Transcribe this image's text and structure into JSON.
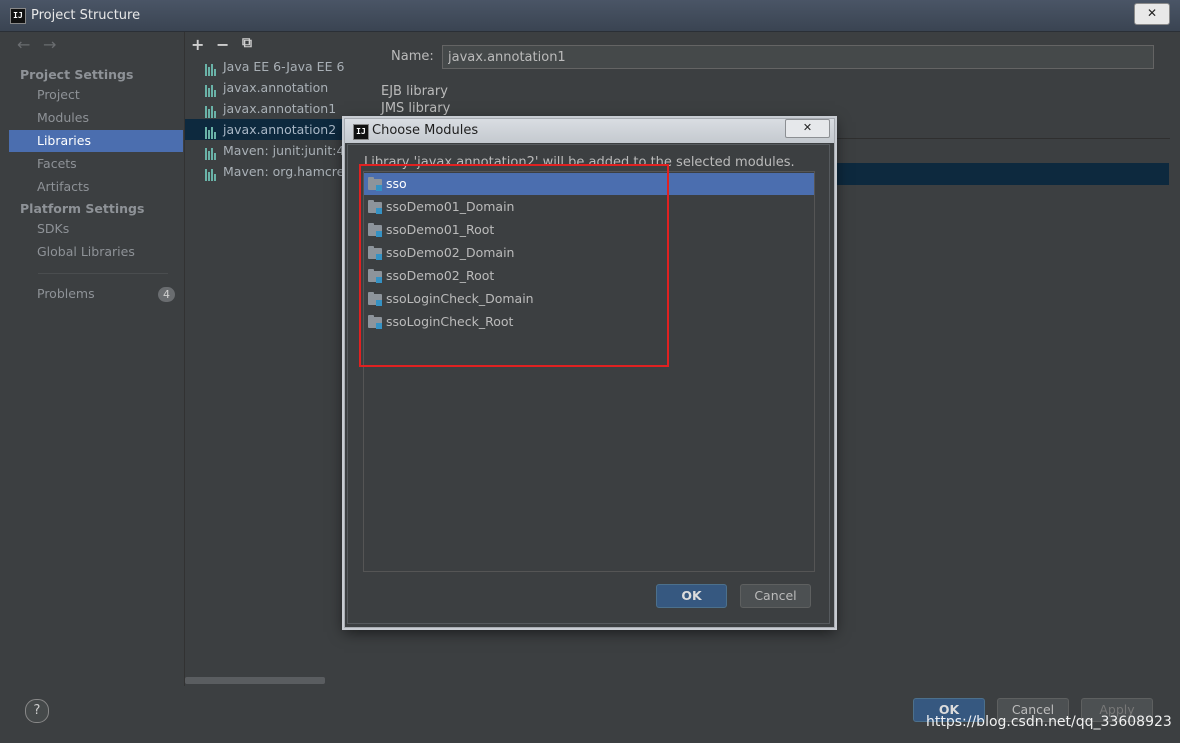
{
  "window": {
    "title": "Project Structure",
    "close_label": "✕"
  },
  "nav": {
    "back_icon": "←",
    "forward_icon": "→",
    "project_settings_header": "Project Settings",
    "project_settings_items": [
      "Project",
      "Modules",
      "Libraries",
      "Facets",
      "Artifacts"
    ],
    "selected_item": "Libraries",
    "platform_settings_header": "Platform Settings",
    "platform_settings_items": [
      "SDKs",
      "Global Libraries"
    ],
    "problems_label": "Problems",
    "problems_count": "4"
  },
  "libraries_toolbar": {
    "add": "+",
    "remove": "−",
    "copy": "⧉"
  },
  "libraries": [
    "Java EE 6-Java EE 6",
    "javax.annotation",
    "javax.annotation1",
    "javax.annotation2",
    "Maven: junit:junit:4.11",
    "Maven: org.hamcrest"
  ],
  "selected_library": "javax.annotation2",
  "detail": {
    "name_label": "Name:",
    "name_value": "javax.annotation1",
    "lines": [
      "EJB library",
      "JMS library"
    ]
  },
  "dialog": {
    "title": "Choose Modules",
    "close_label": "✕",
    "message": "Library 'javax.annotation2' will be added to the selected modules.",
    "modules": [
      "sso",
      "ssoDemo01_Domain",
      "ssoDemo01_Root",
      "ssoDemo02_Domain",
      "ssoDemo02_Root",
      "ssoLoginCheck_Domain",
      "ssoLoginCheck_Root"
    ],
    "selected_module": "sso",
    "ok_label": "OK",
    "cancel_label": "Cancel"
  },
  "footer": {
    "help_label": "?",
    "ok_label": "OK",
    "cancel_label": "Cancel",
    "apply_label": "Apply",
    "watermark": "https://blog.csdn.net/qq_33608923"
  },
  "colors": {
    "selection": "#4b6eaf",
    "highlight_box": "#e02121",
    "primary_button": "#365880"
  }
}
